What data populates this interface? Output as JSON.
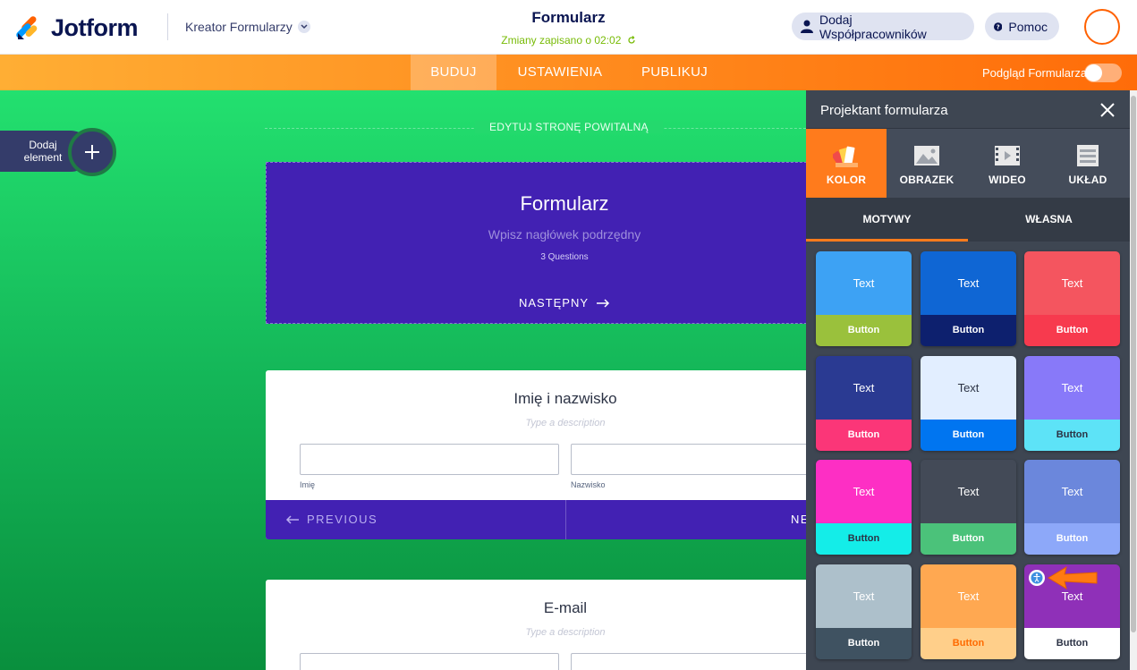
{
  "header": {
    "logo_text": "Jotform",
    "creator_label": "Kreator Formularzy",
    "form_title": "Formularz",
    "saved_status": "Zmiany zapisano o 02:02",
    "collab_label": "Dodaj Współpracowników",
    "help_label": "Pomoc"
  },
  "nav": {
    "tabs": [
      "BUDUJ",
      "USTAWIENIA",
      "PUBLIKUJ"
    ],
    "active_tab": "BUDUJ",
    "preview_label": "Podgląd Formularza"
  },
  "canvas": {
    "add_element_label": "Dodaj element",
    "edit_welcome": "EDYTUJ STRONĘ POWITALNĄ",
    "welcome": {
      "title": "Formularz",
      "subtitle": "Wpisz nagłówek podrzędny",
      "questions": "3 Questions",
      "next_label": "NASTĘPNY"
    },
    "name_question": {
      "title": "Imię i nazwisko",
      "description": "Type a description",
      "sublabel_first": "Imię",
      "sublabel_last": "Nazwisko",
      "prev_label": "PREVIOUS",
      "next_label": "NE"
    },
    "email_question": {
      "title": "E-mail",
      "description": "Type a description"
    }
  },
  "designer": {
    "title": "Projektant formularza",
    "tabs": [
      {
        "label": "KOLOR",
        "icon": "palette-icon"
      },
      {
        "label": "OBRAZEK",
        "icon": "image-icon"
      },
      {
        "label": "WIDEO",
        "icon": "video-icon"
      },
      {
        "label": "UKŁAD",
        "icon": "layout-icon"
      }
    ],
    "active_tab": "KOLOR",
    "subtabs": [
      "MOTYWY",
      "WŁASNA"
    ],
    "active_subtab": "MOTYWY",
    "themes": [
      {
        "text": "Text",
        "button": "Button",
        "top": "#3da2f4",
        "bottom": "#9ac13c",
        "text_color": "#ffffff",
        "btn_color": "#ffffff"
      },
      {
        "text": "Text",
        "button": "Button",
        "top": "#0f66d4",
        "bottom": "#0d206e",
        "text_color": "#ffffff",
        "btn_color": "#ffffff"
      },
      {
        "text": "Text",
        "button": "Button",
        "top": "#f4555f",
        "bottom": "#f73a4e",
        "text_color": "#ffffff",
        "btn_color": "#ffffff"
      },
      {
        "text": "Text",
        "button": "Button",
        "top": "#2a3a92",
        "bottom": "#fb3678",
        "text_color": "#ffffff",
        "btn_color": "#ffffff"
      },
      {
        "text": "Text",
        "button": "Button",
        "top": "#e2eeff",
        "bottom": "#0075f0",
        "text_color": "#2c3345",
        "btn_color": "#ffffff"
      },
      {
        "text": "Text",
        "button": "Button",
        "top": "#8879f9",
        "bottom": "#5de3f7",
        "text_color": "#ffffff",
        "btn_color": "#2c3345"
      },
      {
        "text": "Text",
        "button": "Button",
        "top": "#fd2fc4",
        "bottom": "#14ede8",
        "text_color": "#ffffff",
        "btn_color": "#2c3345"
      },
      {
        "text": "Text",
        "button": "Button",
        "top": "#434a57",
        "bottom": "#4bc27a",
        "text_color": "#ffffff",
        "btn_color": "#ffffff"
      },
      {
        "text": "Text",
        "button": "Button",
        "top": "#6b87dc",
        "bottom": "#8da8f9",
        "text_color": "#ffffff",
        "btn_color": "#ffffff"
      },
      {
        "text": "Text",
        "button": "Button",
        "top": "#adc0cb",
        "bottom": "#3f5261",
        "text_color": "#ffffff",
        "btn_color": "#ffffff"
      },
      {
        "text": "Text",
        "button": "Button",
        "top": "#ffa851",
        "bottom": "#ffcf8a",
        "text_color": "#ffffff",
        "btn_color": "#ff6a00"
      },
      {
        "text": "Text",
        "button": "Button",
        "top": "#8f30b8",
        "bottom": "#ffffff",
        "text_color": "#ffffff",
        "btn_color": "#2c3345"
      }
    ]
  }
}
